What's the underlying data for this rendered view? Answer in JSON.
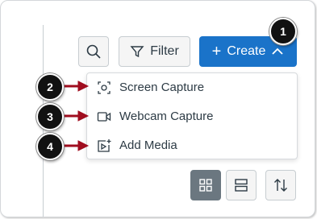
{
  "toolbar": {
    "search_icon": "search-icon",
    "filter_label": "Filter",
    "filter_icon": "filter-icon",
    "create_label": "Create",
    "create_plus": "+",
    "create_chevron": "chevron-up-icon",
    "create_color": "#1a73c9"
  },
  "menu": {
    "items": [
      {
        "label": "Screen Capture",
        "icon": "screen-capture-icon"
      },
      {
        "label": "Webcam Capture",
        "icon": "webcam-icon"
      },
      {
        "label": "Add Media",
        "icon": "add-media-icon"
      }
    ]
  },
  "view_controls": {
    "grid_view_icon": "grid-view-icon",
    "list_view_icon": "list-view-icon",
    "sort_icon": "sort-icon",
    "active_color": "#6b7780"
  },
  "callouts": [
    "1",
    "2",
    "3",
    "4"
  ],
  "callout_arrow_color": "#a00d1f"
}
